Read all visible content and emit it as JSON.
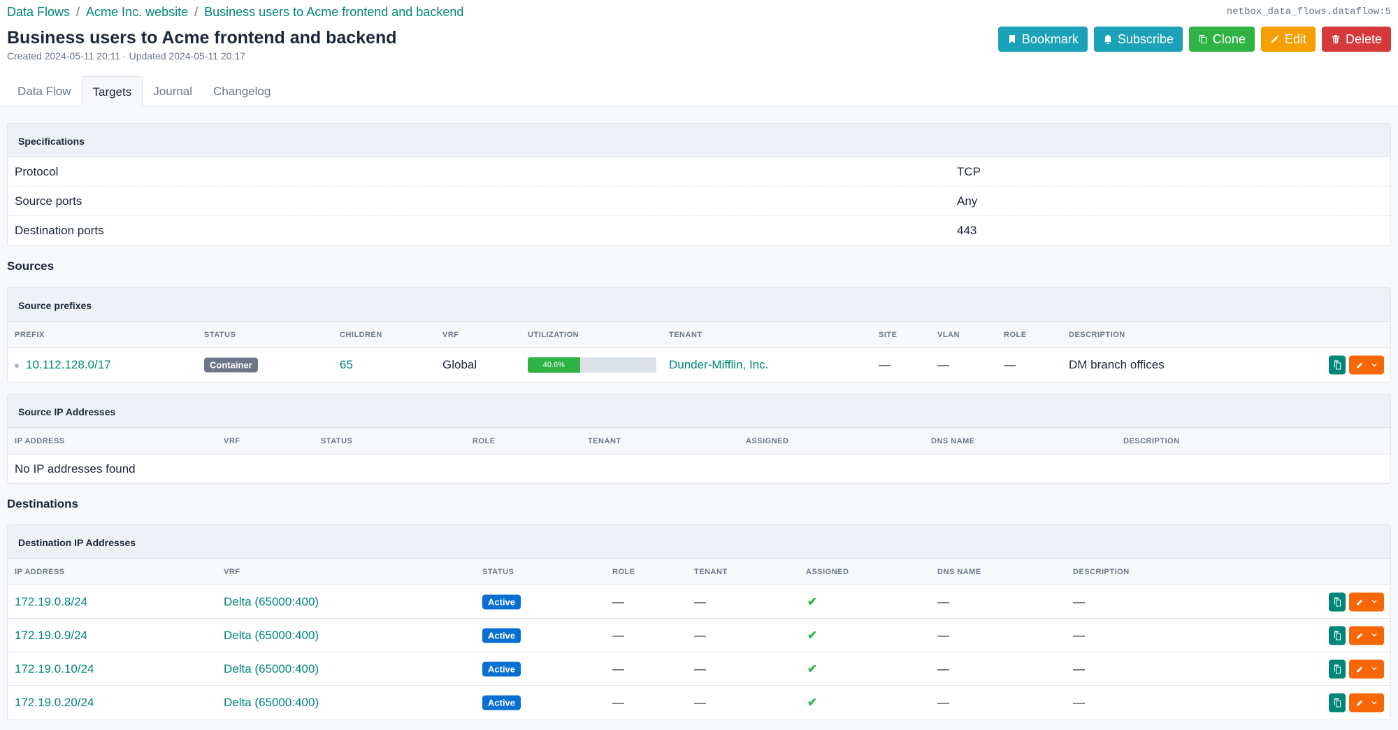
{
  "breadcrumb": [
    "Data Flows",
    "Acme Inc. website",
    "Business users to Acme frontend and backend"
  ],
  "object_id": "netbox_data_flows.dataflow:5",
  "page": {
    "title": "Business users to Acme frontend and backend",
    "meta": "Created 2024-05-11 20:11 · Updated 2024-05-11 20:17"
  },
  "actions": [
    {
      "label": "Bookmark",
      "icon": "bookmark-icon",
      "color": "#1ba1b8"
    },
    {
      "label": "Subscribe",
      "icon": "bell-plus-icon",
      "color": "#1ba1b8"
    },
    {
      "label": "Clone",
      "icon": "copy-icon",
      "color": "#2fb344"
    },
    {
      "label": "Edit",
      "icon": "pencil-icon",
      "color": "#f59f00"
    },
    {
      "label": "Delete",
      "icon": "trash-icon",
      "color": "#d63939"
    }
  ],
  "tabs": [
    {
      "label": "Data Flow",
      "active": false
    },
    {
      "label": "Targets",
      "active": true
    },
    {
      "label": "Journal",
      "active": false
    },
    {
      "label": "Changelog",
      "active": false
    }
  ],
  "specifications": {
    "title": "Specifications",
    "rows": [
      {
        "key": "Protocol",
        "value": "TCP"
      },
      {
        "key": "Source ports",
        "value": "Any"
      },
      {
        "key": "Destination ports",
        "value": "443"
      }
    ]
  },
  "sources": {
    "heading": "Sources",
    "prefixes": {
      "title": "Source prefixes",
      "columns": [
        "PREFIX",
        "STATUS",
        "CHILDREN",
        "VRF",
        "UTILIZATION",
        "TENANT",
        "SITE",
        "VLAN",
        "ROLE",
        "DESCRIPTION"
      ],
      "rows": [
        {
          "prefix": "10.112.128.0/17",
          "status": "Container",
          "status_color": "#6b7789",
          "children": "65",
          "vrf": "Global",
          "utilization": "40.6%",
          "utilization_pct": 40.6,
          "tenant": "Dunder-Mifflin, Inc.",
          "site": "—",
          "vlan": "—",
          "role": "—",
          "description": "DM branch offices"
        }
      ]
    },
    "ip_addresses": {
      "title": "Source IP Addresses",
      "columns": [
        "IP ADDRESS",
        "VRF",
        "STATUS",
        "ROLE",
        "TENANT",
        "ASSIGNED",
        "DNS NAME",
        "DESCRIPTION"
      ],
      "empty": "No IP addresses found"
    }
  },
  "destinations": {
    "heading": "Destinations",
    "ip_addresses": {
      "title": "Destination IP Addresses",
      "columns": [
        "IP ADDRESS",
        "VRF",
        "STATUS",
        "ROLE",
        "TENANT",
        "ASSIGNED",
        "DNS NAME",
        "DESCRIPTION"
      ],
      "rows": [
        {
          "ip": "172.19.0.8/24",
          "vrf": "Delta (65000:400)",
          "status": "Active",
          "role": "—",
          "tenant": "—",
          "assigned": "✔",
          "dns": "—",
          "description": "—"
        },
        {
          "ip": "172.19.0.9/24",
          "vrf": "Delta (65000:400)",
          "status": "Active",
          "role": "—",
          "tenant": "—",
          "assigned": "✔",
          "dns": "—",
          "description": "—"
        },
        {
          "ip": "172.19.0.10/24",
          "vrf": "Delta (65000:400)",
          "status": "Active",
          "role": "—",
          "tenant": "—",
          "assigned": "✔",
          "dns": "—",
          "description": "—"
        },
        {
          "ip": "172.19.0.20/24",
          "vrf": "Delta (65000:400)",
          "status": "Active",
          "role": "—",
          "tenant": "—",
          "assigned": "✔",
          "dns": "—",
          "description": "—"
        }
      ],
      "status_color": "#066fd1"
    }
  }
}
